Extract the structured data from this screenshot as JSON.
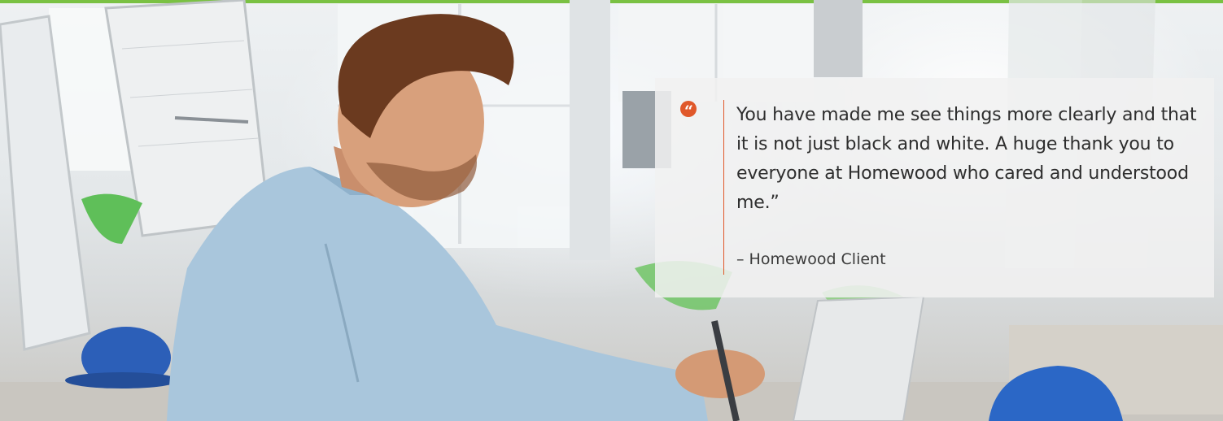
{
  "testimonial": {
    "quote": "You have made me see things more clearly and that it is not just black and white. A huge thank you to everyone at Homewood who cared and understood me.”",
    "attribution": "– Homewood Client"
  },
  "colors": {
    "accent_green": "#7ac143",
    "accent_orange": "#e0582a",
    "text_dark": "#2e2e2e"
  },
  "icons": {
    "quote": "quote-mark-icon"
  }
}
